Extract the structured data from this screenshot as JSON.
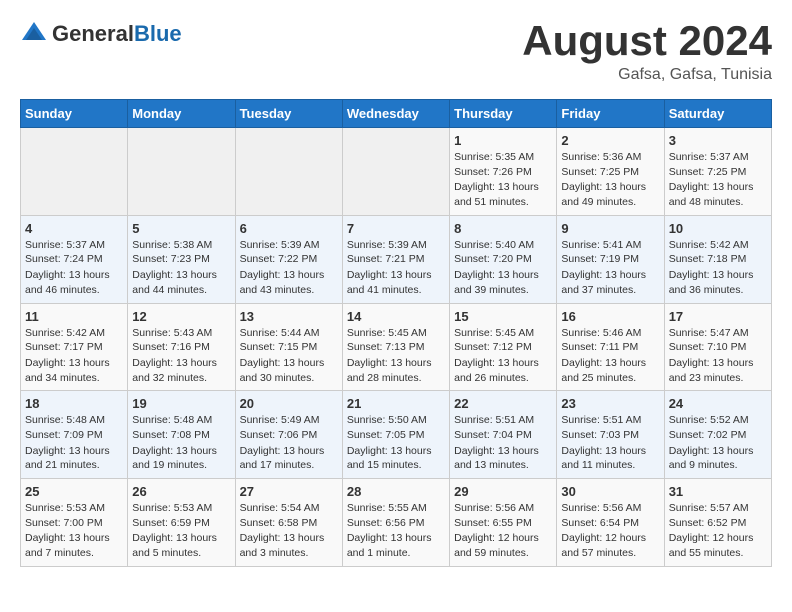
{
  "header": {
    "logo_general": "General",
    "logo_blue": "Blue",
    "month_year": "August 2024",
    "location": "Gafsa, Gafsa, Tunisia"
  },
  "weekdays": [
    "Sunday",
    "Monday",
    "Tuesday",
    "Wednesday",
    "Thursday",
    "Friday",
    "Saturday"
  ],
  "weeks": [
    [
      {
        "day": "",
        "text": ""
      },
      {
        "day": "",
        "text": ""
      },
      {
        "day": "",
        "text": ""
      },
      {
        "day": "",
        "text": ""
      },
      {
        "day": "1",
        "text": "Sunrise: 5:35 AM\nSunset: 7:26 PM\nDaylight: 13 hours and 51 minutes."
      },
      {
        "day": "2",
        "text": "Sunrise: 5:36 AM\nSunset: 7:25 PM\nDaylight: 13 hours and 49 minutes."
      },
      {
        "day": "3",
        "text": "Sunrise: 5:37 AM\nSunset: 7:25 PM\nDaylight: 13 hours and 48 minutes."
      }
    ],
    [
      {
        "day": "4",
        "text": "Sunrise: 5:37 AM\nSunset: 7:24 PM\nDaylight: 13 hours and 46 minutes."
      },
      {
        "day": "5",
        "text": "Sunrise: 5:38 AM\nSunset: 7:23 PM\nDaylight: 13 hours and 44 minutes."
      },
      {
        "day": "6",
        "text": "Sunrise: 5:39 AM\nSunset: 7:22 PM\nDaylight: 13 hours and 43 minutes."
      },
      {
        "day": "7",
        "text": "Sunrise: 5:39 AM\nSunset: 7:21 PM\nDaylight: 13 hours and 41 minutes."
      },
      {
        "day": "8",
        "text": "Sunrise: 5:40 AM\nSunset: 7:20 PM\nDaylight: 13 hours and 39 minutes."
      },
      {
        "day": "9",
        "text": "Sunrise: 5:41 AM\nSunset: 7:19 PM\nDaylight: 13 hours and 37 minutes."
      },
      {
        "day": "10",
        "text": "Sunrise: 5:42 AM\nSunset: 7:18 PM\nDaylight: 13 hours and 36 minutes."
      }
    ],
    [
      {
        "day": "11",
        "text": "Sunrise: 5:42 AM\nSunset: 7:17 PM\nDaylight: 13 hours and 34 minutes."
      },
      {
        "day": "12",
        "text": "Sunrise: 5:43 AM\nSunset: 7:16 PM\nDaylight: 13 hours and 32 minutes."
      },
      {
        "day": "13",
        "text": "Sunrise: 5:44 AM\nSunset: 7:15 PM\nDaylight: 13 hours and 30 minutes."
      },
      {
        "day": "14",
        "text": "Sunrise: 5:45 AM\nSunset: 7:13 PM\nDaylight: 13 hours and 28 minutes."
      },
      {
        "day": "15",
        "text": "Sunrise: 5:45 AM\nSunset: 7:12 PM\nDaylight: 13 hours and 26 minutes."
      },
      {
        "day": "16",
        "text": "Sunrise: 5:46 AM\nSunset: 7:11 PM\nDaylight: 13 hours and 25 minutes."
      },
      {
        "day": "17",
        "text": "Sunrise: 5:47 AM\nSunset: 7:10 PM\nDaylight: 13 hours and 23 minutes."
      }
    ],
    [
      {
        "day": "18",
        "text": "Sunrise: 5:48 AM\nSunset: 7:09 PM\nDaylight: 13 hours and 21 minutes."
      },
      {
        "day": "19",
        "text": "Sunrise: 5:48 AM\nSunset: 7:08 PM\nDaylight: 13 hours and 19 minutes."
      },
      {
        "day": "20",
        "text": "Sunrise: 5:49 AM\nSunset: 7:06 PM\nDaylight: 13 hours and 17 minutes."
      },
      {
        "day": "21",
        "text": "Sunrise: 5:50 AM\nSunset: 7:05 PM\nDaylight: 13 hours and 15 minutes."
      },
      {
        "day": "22",
        "text": "Sunrise: 5:51 AM\nSunset: 7:04 PM\nDaylight: 13 hours and 13 minutes."
      },
      {
        "day": "23",
        "text": "Sunrise: 5:51 AM\nSunset: 7:03 PM\nDaylight: 13 hours and 11 minutes."
      },
      {
        "day": "24",
        "text": "Sunrise: 5:52 AM\nSunset: 7:02 PM\nDaylight: 13 hours and 9 minutes."
      }
    ],
    [
      {
        "day": "25",
        "text": "Sunrise: 5:53 AM\nSunset: 7:00 PM\nDaylight: 13 hours and 7 minutes."
      },
      {
        "day": "26",
        "text": "Sunrise: 5:53 AM\nSunset: 6:59 PM\nDaylight: 13 hours and 5 minutes."
      },
      {
        "day": "27",
        "text": "Sunrise: 5:54 AM\nSunset: 6:58 PM\nDaylight: 13 hours and 3 minutes."
      },
      {
        "day": "28",
        "text": "Sunrise: 5:55 AM\nSunset: 6:56 PM\nDaylight: 13 hours and 1 minute."
      },
      {
        "day": "29",
        "text": "Sunrise: 5:56 AM\nSunset: 6:55 PM\nDaylight: 12 hours and 59 minutes."
      },
      {
        "day": "30",
        "text": "Sunrise: 5:56 AM\nSunset: 6:54 PM\nDaylight: 12 hours and 57 minutes."
      },
      {
        "day": "31",
        "text": "Sunrise: 5:57 AM\nSunset: 6:52 PM\nDaylight: 12 hours and 55 minutes."
      }
    ]
  ]
}
